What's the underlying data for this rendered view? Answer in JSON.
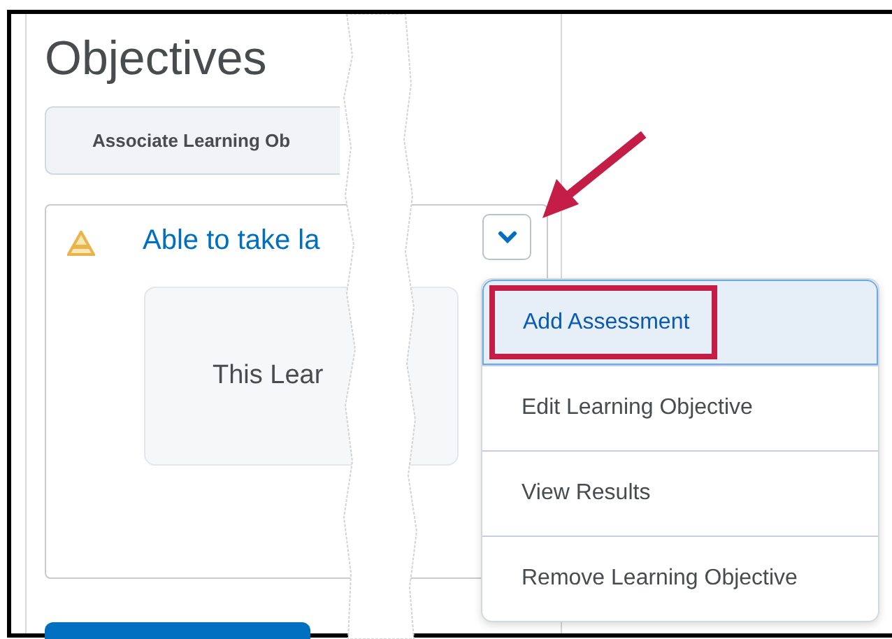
{
  "page": {
    "title": "Objectives"
  },
  "associate_button": {
    "label": "Associate Learning Ob"
  },
  "objective": {
    "title": "Able to take la",
    "message": "This Lear",
    "menu_expanded": true
  },
  "menu": [
    {
      "label": "Add Assessment",
      "selected": true,
      "highlighted": true
    },
    {
      "label": "Edit Learning Objective",
      "selected": false,
      "highlighted": false
    },
    {
      "label": "View Results",
      "selected": false,
      "highlighted": false
    },
    {
      "label": "Remove Learning Objective",
      "selected": false,
      "highlighted": false
    }
  ]
}
